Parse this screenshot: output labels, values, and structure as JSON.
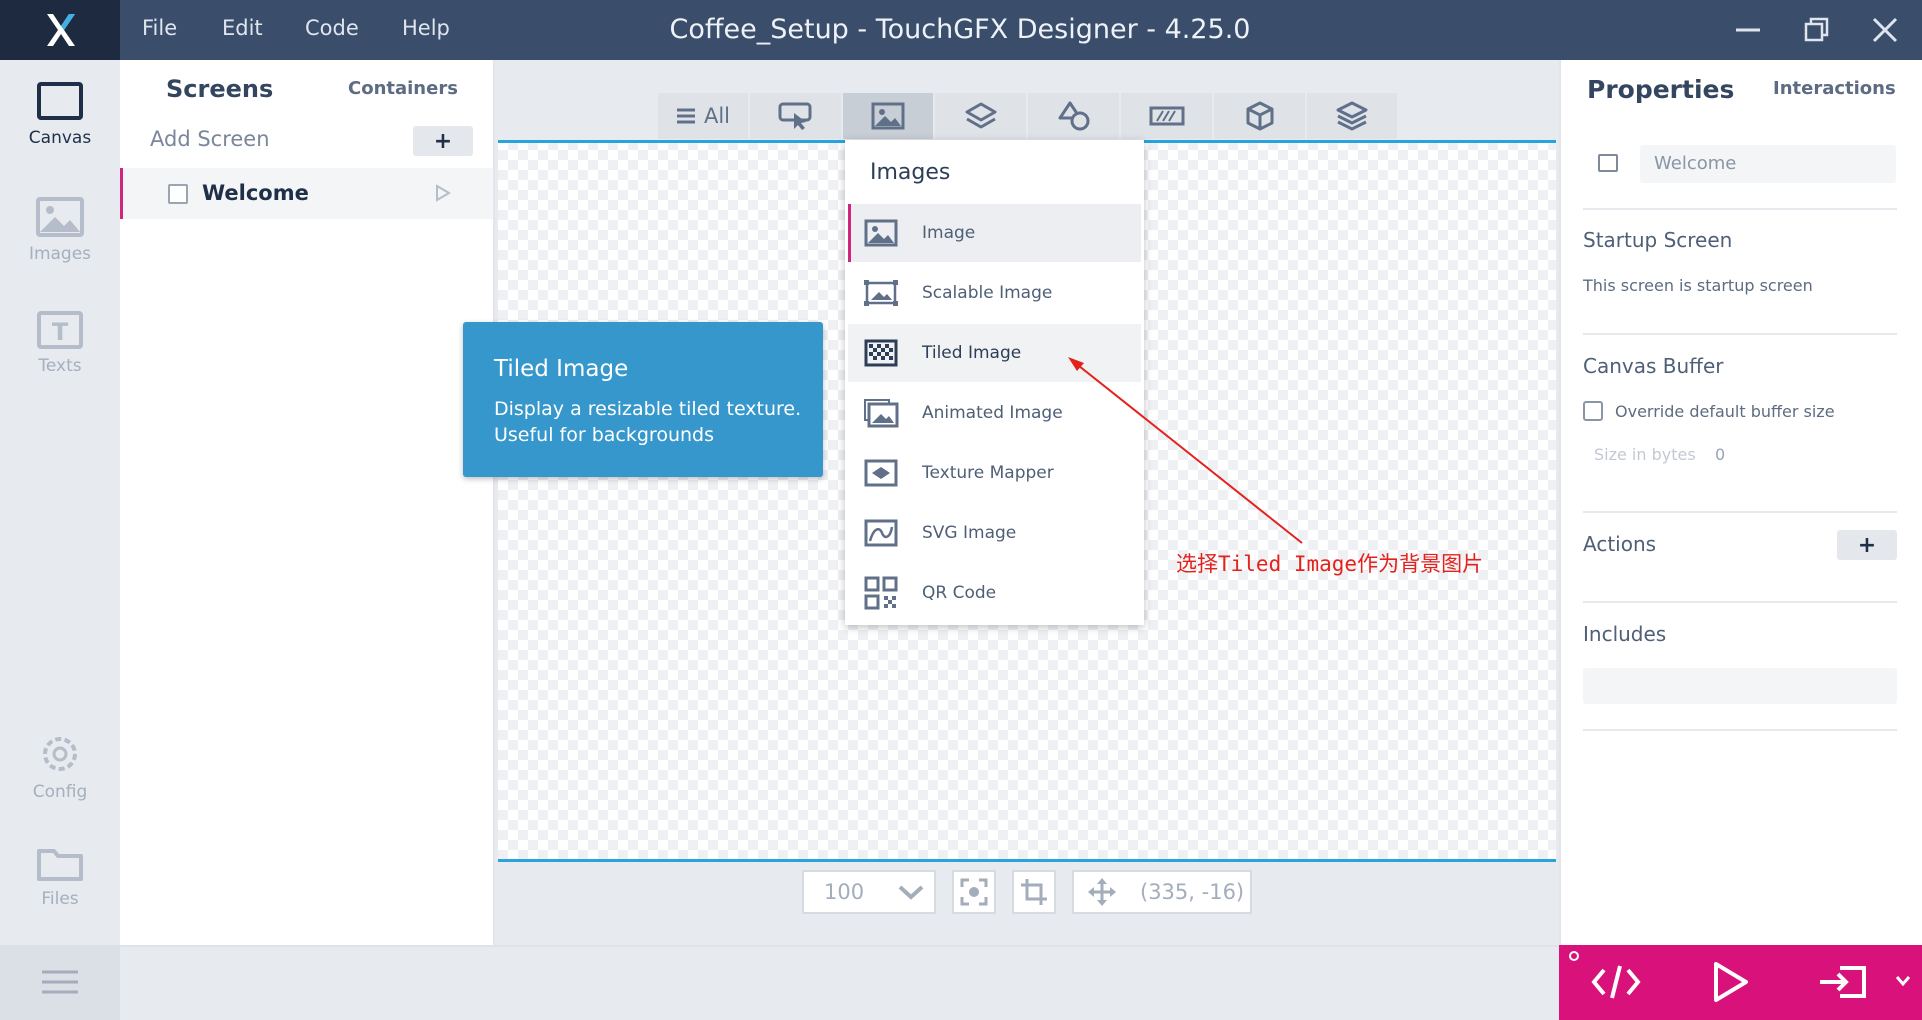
{
  "window": {
    "title": "Coffee_Setup - TouchGFX Designer - 4.25.0",
    "menu": [
      {
        "label": "File"
      },
      {
        "label": "Edit"
      },
      {
        "label": "Code"
      },
      {
        "label": "Help"
      }
    ]
  },
  "rail": {
    "items": [
      {
        "label": "Canvas",
        "icon": "canvas-icon"
      },
      {
        "label": "Images",
        "icon": "image-icon"
      },
      {
        "label": "Texts",
        "icon": "text-icon"
      },
      {
        "label": "Config",
        "icon": "gear-icon"
      },
      {
        "label": "Files",
        "icon": "folder-icon"
      }
    ]
  },
  "screens_panel": {
    "tab_screens": "Screens",
    "tab_containers": "Containers",
    "add_screen_label": "Add Screen",
    "add_button": "+",
    "screens": [
      {
        "name": "Welcome"
      }
    ]
  },
  "widget_toolbar": {
    "all_label": "All"
  },
  "dropdown": {
    "title": "Images",
    "items": [
      {
        "label": "Image",
        "icon": "image-icon"
      },
      {
        "label": "Scalable Image",
        "icon": "scalable-image-icon"
      },
      {
        "label": "Tiled Image",
        "icon": "tiled-image-icon"
      },
      {
        "label": "Animated Image",
        "icon": "animated-image-icon"
      },
      {
        "label": "Texture Mapper",
        "icon": "texture-mapper-icon"
      },
      {
        "label": "SVG Image",
        "icon": "svg-image-icon"
      },
      {
        "label": "QR Code",
        "icon": "qr-code-icon"
      }
    ]
  },
  "tooltip": {
    "title": "Tiled Image",
    "description": "Display a resizable tiled texture. Useful for backgrounds"
  },
  "annotation": {
    "text": "选择Tiled Image作为背景图片",
    "color": "#e3221c"
  },
  "canvas_toolbar": {
    "zoom": "100",
    "coords": "(335, -16)"
  },
  "properties": {
    "title": "Properties",
    "tab_interactions": "Interactions",
    "screen_name": "Welcome",
    "startup_heading": "Startup Screen",
    "startup_text": "This screen is startup screen",
    "buffer_heading": "Canvas Buffer",
    "override_label": "Override default buffer size",
    "size_label": "Size in bytes",
    "size_value": "0",
    "actions_heading": "Actions",
    "actions_add": "+",
    "includes_heading": "Includes"
  },
  "colors": {
    "titlebar": "#3a4d6b",
    "accent": "#d0257f",
    "canvas_line": "#29a3dc",
    "tooltip": "#3597cb",
    "action_bar": "#d8127a"
  }
}
